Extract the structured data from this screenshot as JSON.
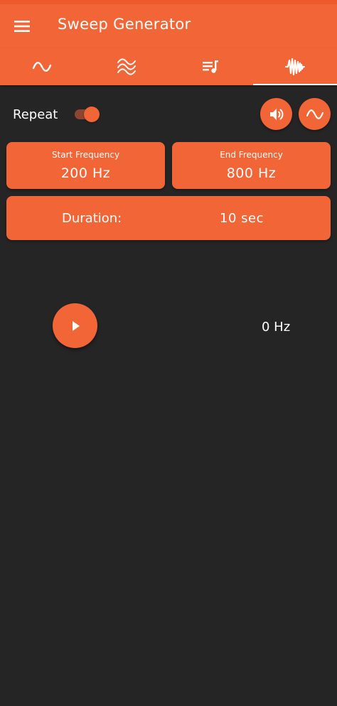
{
  "app": {
    "title": "Sweep Generator",
    "accent_color": "#f16537",
    "background_color": "#252525"
  },
  "appbar": {
    "menu_icon": "hamburger-menu-icon"
  },
  "tabs": [
    {
      "icon": "sine-wave-icon",
      "selected": false
    },
    {
      "icon": "multi-wave-icon",
      "selected": false
    },
    {
      "icon": "playlist-music-icon",
      "selected": false
    },
    {
      "icon": "sweep-waveform-icon",
      "selected": true
    }
  ],
  "controls": {
    "repeat_label": "Repeat",
    "repeat_on": true,
    "volume_icon": "volume-icon",
    "waveform_icon": "sine-wave-icon"
  },
  "start_frequency": {
    "label": "Start Frequency",
    "value": "200 Hz"
  },
  "end_frequency": {
    "label": "End Frequency",
    "value": "800 Hz"
  },
  "duration": {
    "label": "Duration:",
    "value": "10 sec"
  },
  "player": {
    "play_icon": "play-icon",
    "current_frequency": "0 Hz"
  }
}
